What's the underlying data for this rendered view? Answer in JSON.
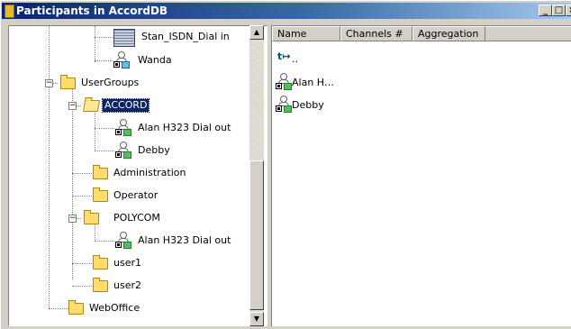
{
  "window": {
    "title": "Participants in AccordDB",
    "controls": {
      "minimize": "_",
      "maximize": "□",
      "close": "×"
    }
  },
  "tree": {
    "nodes": [
      {
        "label": "Stan_ISDN_Dial in",
        "icon": "isdn-device-icon"
      },
      {
        "label": "Wanda",
        "icon": "user-icon"
      },
      {
        "label": "UserGroups",
        "icon": "folder-icon",
        "expander": "−"
      },
      {
        "label": "ACCORD",
        "icon": "folder-open-icon",
        "expander": "−",
        "selected": true
      },
      {
        "label": "Alan H323 Dial out",
        "icon": "user-icon"
      },
      {
        "label": "Debby",
        "icon": "user-icon"
      },
      {
        "label": "Administration",
        "icon": "folder-icon"
      },
      {
        "label": "Operator",
        "icon": "folder-icon"
      },
      {
        "label": "POLYCOM",
        "icon": "folder-icon",
        "expander": "−"
      },
      {
        "label": "Alan H323 Dial out",
        "icon": "user-icon"
      },
      {
        "label": "user1",
        "icon": "folder-icon"
      },
      {
        "label": "user2",
        "icon": "folder-icon"
      },
      {
        "label": "WebOffice",
        "icon": "folder-icon"
      }
    ],
    "scrollbar": {
      "up": "▲",
      "down": "▼"
    }
  },
  "list": {
    "columns": [
      "Name",
      "Channels #",
      "Aggregation"
    ],
    "up_label": "..",
    "up_icon": "up-folder-icon",
    "items": [
      {
        "label": "Alan H…",
        "icon": "user-icon"
      },
      {
        "label": "Debby",
        "icon": "user-icon"
      }
    ]
  }
}
